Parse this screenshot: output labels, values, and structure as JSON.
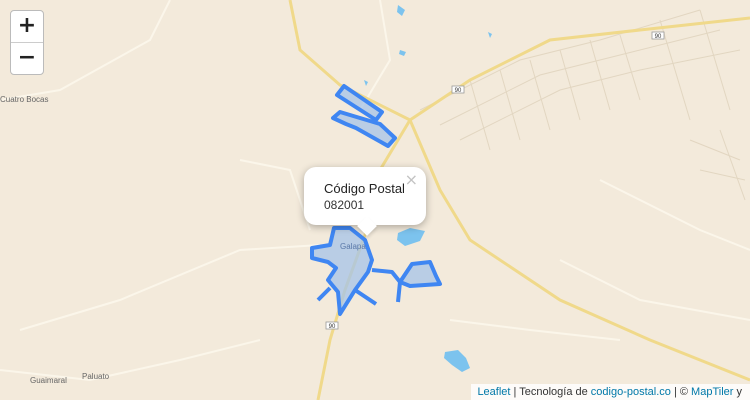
{
  "map": {
    "colors": {
      "land": "#f3eadb",
      "road": "#f0d98a",
      "water": "#7cc3ee",
      "boundary": "#3f86f2",
      "boundary_fill": "#a6c3e8"
    },
    "zoom": {
      "in_label": "+",
      "out_label": "−"
    },
    "place_labels": {
      "cuatro_bocas": "Cuatro Bocas",
      "galapa": "Galapa",
      "guaimaral": "Guaimaral",
      "paluato": "Paluato"
    },
    "road_shields": [
      "90",
      "90",
      "90"
    ],
    "popup": {
      "title": "Código Postal",
      "code": "082001",
      "close_glyph": "×"
    },
    "attribution": {
      "leaflet": "Leaflet",
      "sep1": " | Tecnología de ",
      "site": "codigo-postal.co",
      "sep2": " | © ",
      "tiler": "MapTiler",
      "tail": " y"
    }
  }
}
